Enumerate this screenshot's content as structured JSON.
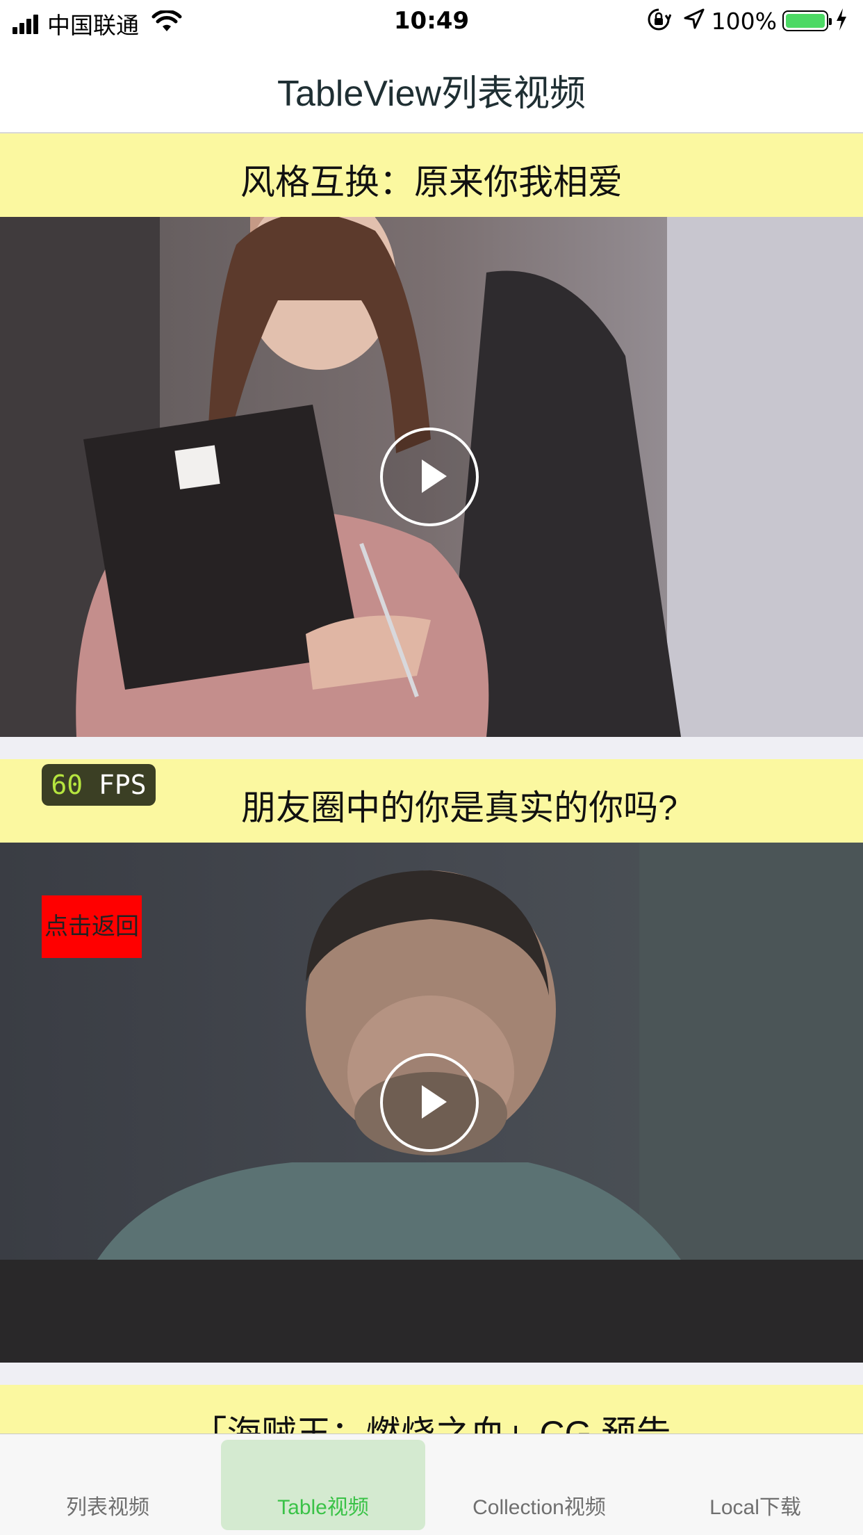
{
  "status_bar": {
    "carrier": "中国联通",
    "time": "10:49",
    "battery_percent": "100%",
    "battery_level": 1.0,
    "battery_color": "#4cd964",
    "icons": [
      "signal-icon",
      "wifi-icon",
      "orientation-lock-icon",
      "location-icon",
      "battery-icon",
      "charging-icon"
    ]
  },
  "nav": {
    "title": "TableView列表视频"
  },
  "videos": [
    {
      "title": "风格互换：原来你我相爱"
    },
    {
      "title": "朋友圈中的你是真实的你吗?"
    },
    {
      "title": "「海贼王：燃烧之血」CG 预告"
    }
  ],
  "fps": {
    "value": "60",
    "unit": "FPS"
  },
  "back_button": {
    "label": "点击返回"
  },
  "tabs": [
    {
      "label": "列表视频",
      "active": false
    },
    {
      "label": "Table视频",
      "active": true
    },
    {
      "label": "Collection视频",
      "active": false
    },
    {
      "label": "Local下载",
      "active": false
    }
  ],
  "colors": {
    "title_bar_bg": "#fbf8a0",
    "tab_active_text": "#3ac247",
    "tab_active_bg": "#d4ead0",
    "back_button_bg": "#ff0000"
  }
}
